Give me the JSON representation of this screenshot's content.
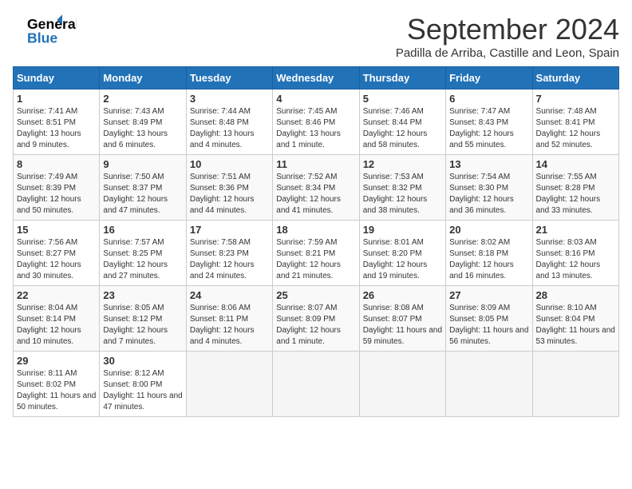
{
  "header": {
    "logo_line1": "General",
    "logo_line2": "Blue",
    "month": "September 2024",
    "location": "Padilla de Arriba, Castille and Leon, Spain"
  },
  "days_of_week": [
    "Sunday",
    "Monday",
    "Tuesday",
    "Wednesday",
    "Thursday",
    "Friday",
    "Saturday"
  ],
  "weeks": [
    [
      {
        "num": "1",
        "sunrise": "7:41 AM",
        "sunset": "8:51 PM",
        "daylight": "13 hours and 9 minutes."
      },
      {
        "num": "2",
        "sunrise": "7:43 AM",
        "sunset": "8:49 PM",
        "daylight": "13 hours and 6 minutes."
      },
      {
        "num": "3",
        "sunrise": "7:44 AM",
        "sunset": "8:48 PM",
        "daylight": "13 hours and 4 minutes."
      },
      {
        "num": "4",
        "sunrise": "7:45 AM",
        "sunset": "8:46 PM",
        "daylight": "13 hours and 1 minute."
      },
      {
        "num": "5",
        "sunrise": "7:46 AM",
        "sunset": "8:44 PM",
        "daylight": "12 hours and 58 minutes."
      },
      {
        "num": "6",
        "sunrise": "7:47 AM",
        "sunset": "8:43 PM",
        "daylight": "12 hours and 55 minutes."
      },
      {
        "num": "7",
        "sunrise": "7:48 AM",
        "sunset": "8:41 PM",
        "daylight": "12 hours and 52 minutes."
      }
    ],
    [
      {
        "num": "8",
        "sunrise": "7:49 AM",
        "sunset": "8:39 PM",
        "daylight": "12 hours and 50 minutes."
      },
      {
        "num": "9",
        "sunrise": "7:50 AM",
        "sunset": "8:37 PM",
        "daylight": "12 hours and 47 minutes."
      },
      {
        "num": "10",
        "sunrise": "7:51 AM",
        "sunset": "8:36 PM",
        "daylight": "12 hours and 44 minutes."
      },
      {
        "num": "11",
        "sunrise": "7:52 AM",
        "sunset": "8:34 PM",
        "daylight": "12 hours and 41 minutes."
      },
      {
        "num": "12",
        "sunrise": "7:53 AM",
        "sunset": "8:32 PM",
        "daylight": "12 hours and 38 minutes."
      },
      {
        "num": "13",
        "sunrise": "7:54 AM",
        "sunset": "8:30 PM",
        "daylight": "12 hours and 36 minutes."
      },
      {
        "num": "14",
        "sunrise": "7:55 AM",
        "sunset": "8:28 PM",
        "daylight": "12 hours and 33 minutes."
      }
    ],
    [
      {
        "num": "15",
        "sunrise": "7:56 AM",
        "sunset": "8:27 PM",
        "daylight": "12 hours and 30 minutes."
      },
      {
        "num": "16",
        "sunrise": "7:57 AM",
        "sunset": "8:25 PM",
        "daylight": "12 hours and 27 minutes."
      },
      {
        "num": "17",
        "sunrise": "7:58 AM",
        "sunset": "8:23 PM",
        "daylight": "12 hours and 24 minutes."
      },
      {
        "num": "18",
        "sunrise": "7:59 AM",
        "sunset": "8:21 PM",
        "daylight": "12 hours and 21 minutes."
      },
      {
        "num": "19",
        "sunrise": "8:01 AM",
        "sunset": "8:20 PM",
        "daylight": "12 hours and 19 minutes."
      },
      {
        "num": "20",
        "sunrise": "8:02 AM",
        "sunset": "8:18 PM",
        "daylight": "12 hours and 16 minutes."
      },
      {
        "num": "21",
        "sunrise": "8:03 AM",
        "sunset": "8:16 PM",
        "daylight": "12 hours and 13 minutes."
      }
    ],
    [
      {
        "num": "22",
        "sunrise": "8:04 AM",
        "sunset": "8:14 PM",
        "daylight": "12 hours and 10 minutes."
      },
      {
        "num": "23",
        "sunrise": "8:05 AM",
        "sunset": "8:12 PM",
        "daylight": "12 hours and 7 minutes."
      },
      {
        "num": "24",
        "sunrise": "8:06 AM",
        "sunset": "8:11 PM",
        "daylight": "12 hours and 4 minutes."
      },
      {
        "num": "25",
        "sunrise": "8:07 AM",
        "sunset": "8:09 PM",
        "daylight": "12 hours and 1 minute."
      },
      {
        "num": "26",
        "sunrise": "8:08 AM",
        "sunset": "8:07 PM",
        "daylight": "11 hours and 59 minutes."
      },
      {
        "num": "27",
        "sunrise": "8:09 AM",
        "sunset": "8:05 PM",
        "daylight": "11 hours and 56 minutes."
      },
      {
        "num": "28",
        "sunrise": "8:10 AM",
        "sunset": "8:04 PM",
        "daylight": "11 hours and 53 minutes."
      }
    ],
    [
      {
        "num": "29",
        "sunrise": "8:11 AM",
        "sunset": "8:02 PM",
        "daylight": "11 hours and 50 minutes."
      },
      {
        "num": "30",
        "sunrise": "8:12 AM",
        "sunset": "8:00 PM",
        "daylight": "11 hours and 47 minutes."
      },
      null,
      null,
      null,
      null,
      null
    ]
  ],
  "labels": {
    "sunrise": "Sunrise:",
    "sunset": "Sunset:",
    "daylight": "Daylight:"
  }
}
